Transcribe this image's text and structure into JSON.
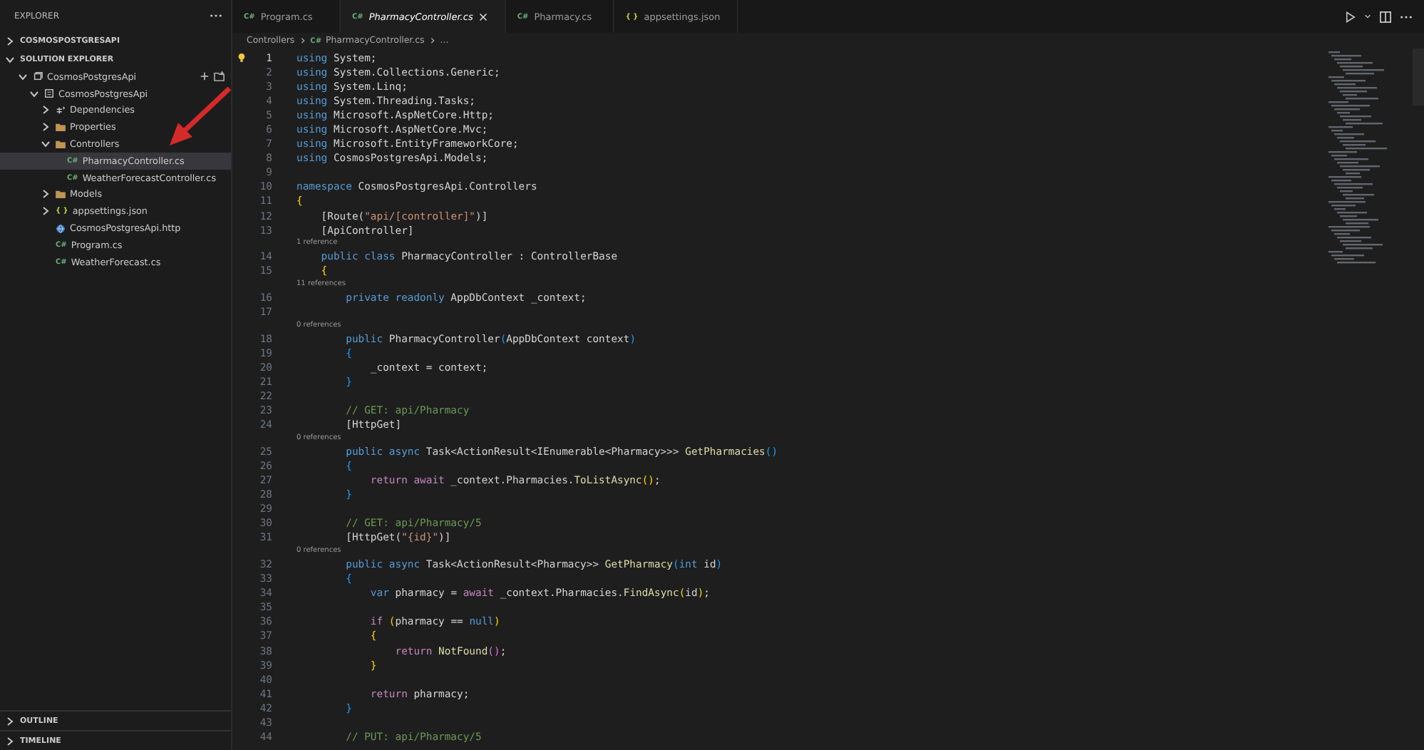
{
  "sidebar": {
    "title": "EXPLORER",
    "sections": [
      {
        "title": "COSMOSPOSTGRESAPI",
        "expanded": false
      },
      {
        "title": "SOLUTION EXPLORER",
        "expanded": true
      }
    ],
    "tree": [
      {
        "label": "CosmosPostgresApi",
        "kind": "solution",
        "expanded": true,
        "selected": false,
        "children": [
          {
            "label": "CosmosPostgresApi",
            "kind": "project",
            "expanded": true,
            "selected": false,
            "children": [
              {
                "label": "Dependencies",
                "kind": "dependencies",
                "expanded": false,
                "selected": false
              },
              {
                "label": "Properties",
                "kind": "folder",
                "expanded": false,
                "selected": false
              },
              {
                "label": "Controllers",
                "kind": "folder",
                "expanded": true,
                "selected": false,
                "children": [
                  {
                    "label": "PharmacyController.cs",
                    "kind": "csharp",
                    "badge": "C#",
                    "selected": true
                  },
                  {
                    "label": "WeatherForecastController.cs",
                    "kind": "csharp",
                    "badge": "C#",
                    "selected": false
                  }
                ]
              },
              {
                "label": "Models",
                "kind": "folder",
                "expanded": false,
                "selected": false
              },
              {
                "label": "appsettings.json",
                "kind": "json",
                "badge": "{ }",
                "expanded": false,
                "selected": false
              },
              {
                "label": "CosmosPostgresApi.http",
                "kind": "http",
                "selected": false
              },
              {
                "label": "Program.cs",
                "kind": "csharp",
                "badge": "C#",
                "selected": false
              },
              {
                "label": "WeatherForecast.cs",
                "kind": "csharp",
                "badge": "C#",
                "selected": false
              }
            ]
          }
        ]
      }
    ],
    "bottom_sections": [
      {
        "title": "OUTLINE",
        "expanded": false
      },
      {
        "title": "TIMELINE",
        "expanded": false
      }
    ]
  },
  "tabs": [
    {
      "label": "Program.cs",
      "kind": "csharp",
      "badge": "C#",
      "selected": false,
      "preview": false
    },
    {
      "label": "PharmacyController.cs",
      "kind": "csharp",
      "badge": "C#",
      "selected": true,
      "preview": true
    },
    {
      "label": "Pharmacy.cs",
      "kind": "csharp",
      "badge": "C#",
      "selected": false,
      "preview": false
    },
    {
      "label": "appsettings.json",
      "kind": "json",
      "badge": "{ }",
      "selected": false,
      "preview": false
    }
  ],
  "breadcrumb": {
    "folder": "Controllers",
    "badge": "C#",
    "file": "PharmacyController.cs",
    "more": "..."
  },
  "code": {
    "lines": [
      {
        "number": "1",
        "selected": true,
        "lightbulb": true,
        "tokens": [
          {
            "kind": "kw",
            "text": "using"
          },
          {
            "kind": "id",
            "text": " System;"
          }
        ]
      },
      {
        "number": "2",
        "selected": false,
        "tokens": [
          {
            "kind": "kw",
            "text": "using"
          },
          {
            "kind": "id",
            "text": " System.Collections.Generic;"
          }
        ]
      },
      {
        "number": "3",
        "selected": false,
        "tokens": [
          {
            "kind": "kw",
            "text": "using"
          },
          {
            "kind": "id",
            "text": " System.Linq;"
          }
        ]
      },
      {
        "number": "4",
        "selected": false,
        "tokens": [
          {
            "kind": "kw",
            "text": "using"
          },
          {
            "kind": "id",
            "text": " System.Threading.Tasks;"
          }
        ]
      },
      {
        "number": "5",
        "selected": false,
        "tokens": [
          {
            "kind": "kw",
            "text": "using"
          },
          {
            "kind": "id",
            "text": " Microsoft.AspNetCore.Http;"
          }
        ]
      },
      {
        "number": "6",
        "selected": false,
        "tokens": [
          {
            "kind": "kw",
            "text": "using"
          },
          {
            "kind": "id",
            "text": " Microsoft.AspNetCore.Mvc;"
          }
        ]
      },
      {
        "number": "7",
        "selected": false,
        "tokens": [
          {
            "kind": "kw",
            "text": "using"
          },
          {
            "kind": "id",
            "text": " Microsoft.EntityFrameworkCore;"
          }
        ]
      },
      {
        "number": "8",
        "selected": false,
        "tokens": [
          {
            "kind": "kw",
            "text": "using"
          },
          {
            "kind": "id",
            "text": " CosmosPostgresApi.Models;"
          }
        ]
      },
      {
        "number": "9",
        "selected": false
      },
      {
        "number": "10",
        "selected": false,
        "tokens": [
          {
            "kind": "kw",
            "text": "namespace"
          },
          {
            "kind": "id",
            "text": " CosmosPostgresApi.Controllers"
          }
        ]
      },
      {
        "number": "11",
        "selected": false,
        "tokens": [
          {
            "kind": "bracket",
            "text": "{"
          }
        ]
      },
      {
        "number": "12",
        "selected": false,
        "tokens": [
          {
            "kind": "id",
            "text": "    [Route("
          },
          {
            "kind": "str",
            "text": "\"api/[controller]\""
          },
          {
            "kind": "id",
            "text": ")]"
          }
        ]
      },
      {
        "number": "13",
        "selected": false,
        "tokens": [
          {
            "kind": "id",
            "text": "    [ApiController]"
          }
        ]
      },
      {
        "number": "14",
        "selected": false,
        "codelens": "1 reference",
        "tokens": [
          {
            "kind": "kw",
            "text": "    public class"
          },
          {
            "kind": "type",
            "text": " PharmacyController"
          },
          {
            "kind": "id",
            "text": " : "
          },
          {
            "kind": "type",
            "text": "ControllerBase"
          }
        ]
      },
      {
        "number": "15",
        "selected": false,
        "tokens": [
          {
            "kind": "bracket",
            "text": "    {"
          }
        ]
      },
      {
        "number": "16",
        "selected": false,
        "codelens": "11 references",
        "tokens": [
          {
            "kind": "kw",
            "text": "        private readonly"
          },
          {
            "kind": "id",
            "text": " AppDbContext _context;"
          }
        ]
      },
      {
        "number": "17",
        "selected": false
      },
      {
        "number": "18",
        "selected": false,
        "codelens": "0 references",
        "tokens": [
          {
            "kind": "kw",
            "text": "        public"
          },
          {
            "kind": "id",
            "text": " PharmacyController"
          },
          {
            "kind": "bracket2",
            "text": "("
          },
          {
            "kind": "id",
            "text": "AppDbContext context"
          },
          {
            "kind": "bracket2",
            "text": ")"
          }
        ]
      },
      {
        "number": "19",
        "selected": false,
        "tokens": [
          {
            "kind": "bracket2",
            "text": "        {"
          }
        ]
      },
      {
        "number": "20",
        "selected": false,
        "tokens": [
          {
            "kind": "id",
            "text": "            _context = context;"
          }
        ]
      },
      {
        "number": "21",
        "selected": false,
        "tokens": [
          {
            "kind": "bracket2",
            "text": "        }"
          }
        ]
      },
      {
        "number": "22",
        "selected": false
      },
      {
        "number": "23",
        "selected": false,
        "tokens": [
          {
            "kind": "comment",
            "text": "        // GET: api/Pharmacy"
          }
        ]
      },
      {
        "number": "24",
        "selected": false,
        "tokens": [
          {
            "kind": "id",
            "text": "        [HttpGet]"
          }
        ]
      },
      {
        "number": "25",
        "selected": false,
        "codelens": "0 references",
        "tokens": [
          {
            "kind": "kw",
            "text": "        public async"
          },
          {
            "kind": "id",
            "text": " Task<ActionResult<IEnumerable<Pharmacy>>> "
          },
          {
            "kind": "fn",
            "text": "GetPharmacies"
          },
          {
            "kind": "bracket2",
            "text": "()"
          }
        ]
      },
      {
        "number": "26",
        "selected": false,
        "tokens": [
          {
            "kind": "bracket2",
            "text": "        {"
          }
        ]
      },
      {
        "number": "27",
        "selected": false,
        "tokens": [
          {
            "kind": "ctrl",
            "text": "            return await"
          },
          {
            "kind": "id",
            "text": " _context.Pharmacies."
          },
          {
            "kind": "fn",
            "text": "ToListAsync"
          },
          {
            "kind": "bracket",
            "text": "()"
          },
          {
            "kind": "id",
            "text": ";"
          }
        ]
      },
      {
        "number": "28",
        "selected": false,
        "tokens": [
          {
            "kind": "bracket2",
            "text": "        }"
          }
        ]
      },
      {
        "number": "29",
        "selected": false
      },
      {
        "number": "30",
        "selected": false,
        "tokens": [
          {
            "kind": "comment",
            "text": "        // GET: api/Pharmacy/5"
          }
        ]
      },
      {
        "number": "31",
        "selected": false,
        "tokens": [
          {
            "kind": "id",
            "text": "        [HttpGet("
          },
          {
            "kind": "str",
            "text": "\"{id}\""
          },
          {
            "kind": "id",
            "text": ")]"
          }
        ]
      },
      {
        "number": "32",
        "selected": false,
        "codelens": "0 references",
        "tokens": [
          {
            "kind": "kw",
            "text": "        public async"
          },
          {
            "kind": "id",
            "text": " Task<ActionResult<Pharmacy>> "
          },
          {
            "kind": "fn",
            "text": "GetPharmacy"
          },
          {
            "kind": "bracket2",
            "text": "("
          },
          {
            "kind": "kw",
            "text": "int"
          },
          {
            "kind": "id",
            "text": " id"
          },
          {
            "kind": "bracket2",
            "text": ")"
          }
        ]
      },
      {
        "number": "33",
        "selected": false,
        "tokens": [
          {
            "kind": "bracket2",
            "text": "        {"
          }
        ]
      },
      {
        "number": "34",
        "selected": false,
        "tokens": [
          {
            "kind": "kw",
            "text": "            var"
          },
          {
            "kind": "id",
            "text": " pharmacy = "
          },
          {
            "kind": "ctrl",
            "text": "await"
          },
          {
            "kind": "id",
            "text": " _context.Pharmacies."
          },
          {
            "kind": "fn",
            "text": "FindAsync"
          },
          {
            "kind": "bracket",
            "text": "("
          },
          {
            "kind": "id",
            "text": "id"
          },
          {
            "kind": "bracket",
            "text": ")"
          },
          {
            "kind": "id",
            "text": ";"
          }
        ]
      },
      {
        "number": "35",
        "selected": false
      },
      {
        "number": "36",
        "selected": false,
        "tokens": [
          {
            "kind": "ctrl",
            "text": "            if"
          },
          {
            "kind": "bracket",
            "text": " ("
          },
          {
            "kind": "id",
            "text": "pharmacy == "
          },
          {
            "kind": "kw",
            "text": "null"
          },
          {
            "kind": "bracket",
            "text": ")"
          }
        ]
      },
      {
        "number": "37",
        "selected": false,
        "tokens": [
          {
            "kind": "bracket",
            "text": "            {"
          }
        ]
      },
      {
        "number": "38",
        "selected": false,
        "tokens": [
          {
            "kind": "ctrl",
            "text": "                return "
          },
          {
            "kind": "fn",
            "text": "NotFound"
          },
          {
            "kind": "bracket3",
            "text": "()"
          },
          {
            "kind": "id",
            "text": ";"
          }
        ]
      },
      {
        "number": "39",
        "selected": false,
        "tokens": [
          {
            "kind": "bracket",
            "text": "            }"
          }
        ]
      },
      {
        "number": "40",
        "selected": false
      },
      {
        "number": "41",
        "selected": false,
        "tokens": [
          {
            "kind": "ctrl",
            "text": "            return"
          },
          {
            "kind": "id",
            "text": " pharmacy;"
          }
        ]
      },
      {
        "number": "42",
        "selected": false,
        "tokens": [
          {
            "kind": "bracket2",
            "text": "        }"
          }
        ]
      },
      {
        "number": "43",
        "selected": false
      },
      {
        "number": "44",
        "selected": false,
        "tokens": [
          {
            "kind": "comment",
            "text": "        // PUT: api/Pharmacy/5"
          }
        ]
      }
    ]
  }
}
